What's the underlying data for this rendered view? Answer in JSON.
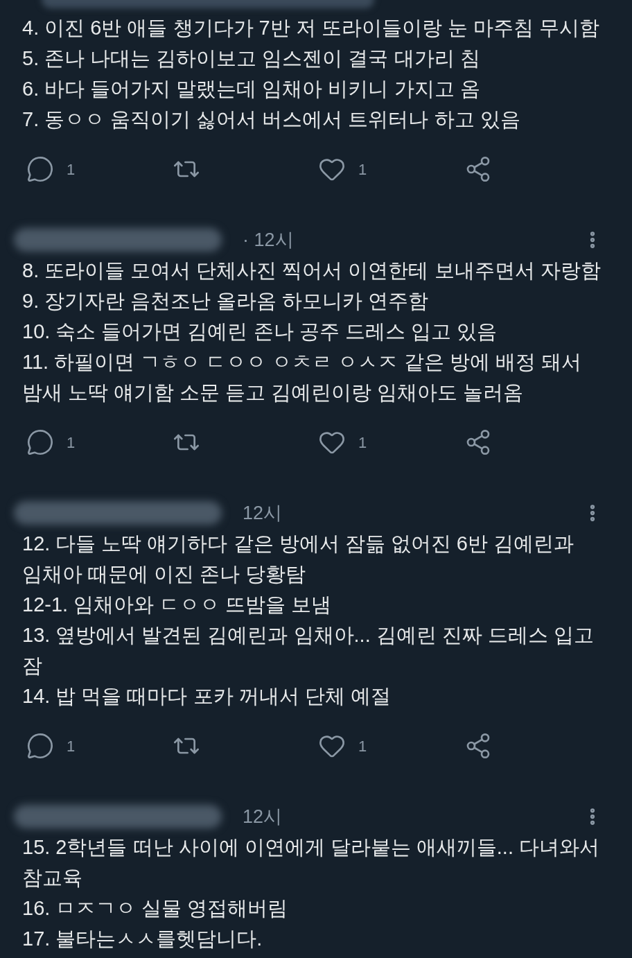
{
  "tweets": [
    {
      "items": [
        [
          "4. 이진 6반 애들 챙기다가 7반 저 또라이들이랑 눈 마주침 무시함"
        ],
        [
          "5. 존나 나대는 김하이보고 임스젠이 결국 대가리 침"
        ],
        [
          "6. 바다 들어가지 말랬는데 임채아 비키니 가지고 옴"
        ],
        [
          "7. 동ㅇㅇ 움직이기 싫어서 버스에서 트위터나 하고 있음"
        ]
      ],
      "actions": [
        {
          "kind": "reply",
          "count": "1"
        },
        {
          "kind": "retweet"
        },
        {
          "kind": "like",
          "count": "1"
        },
        {
          "kind": "share"
        }
      ]
    },
    {
      "time": "· 12시",
      "items": [
        [
          "8. 또라이들 모여서 단체사진 찍어서 이연한테 보내주면서 자랑함"
        ],
        [
          "9. 장기자란 음천조난 올라옴 하모니카 연주함"
        ],
        [
          "10. 숙소 들어가면 김예린 존나 공주 드레스 입고 있음"
        ],
        [
          "11. 하필이면 ㄱㅎㅇ ㄷㅇㅇ ㅇㅊㄹ ㅇㅅㅈ 같은 방에 배정 돼서",
          "밤새 노딱 얘기함 소문 듣고 김예린이랑 임채아도 놀러옴"
        ]
      ],
      "actions": [
        {
          "kind": "reply",
          "count": "1"
        },
        {
          "kind": "retweet"
        },
        {
          "kind": "like",
          "count": "1"
        },
        {
          "kind": "share"
        }
      ]
    },
    {
      "time": "12시",
      "items": [
        [
          "12. 다들 노딱 얘기하다 같은 방에서 잠듦 없어진 6반 김예린과",
          "임채아 때문에 이진 존나 당황탐"
        ],
        [
          "12-1. 임채아와 ㄷㅇㅇ 뜨밤을 보냄"
        ],
        [
          "13. 옆방에서 발견된 김예린과 임채아... 김예린 진짜 드레스 입고",
          "잠"
        ],
        [
          "14. 밥 먹을 때마다 포카 꺼내서 단체 예절"
        ]
      ],
      "actions": [
        {
          "kind": "reply",
          "count": "1"
        },
        {
          "kind": "retweet"
        },
        {
          "kind": "like",
          "count": "1"
        },
        {
          "kind": "share"
        }
      ]
    },
    {
      "time": "12시",
      "items": [
        [
          "15. 2학년들 떠난 사이에 이연에게 달라붙는 애새끼들... 다녀와서",
          "참교육"
        ],
        [
          "16. ㅁㅈㄱㅇ 실물 영접해버림"
        ],
        [
          "17. 불타는ㅅㅅ를헷담니다."
        ]
      ]
    }
  ]
}
